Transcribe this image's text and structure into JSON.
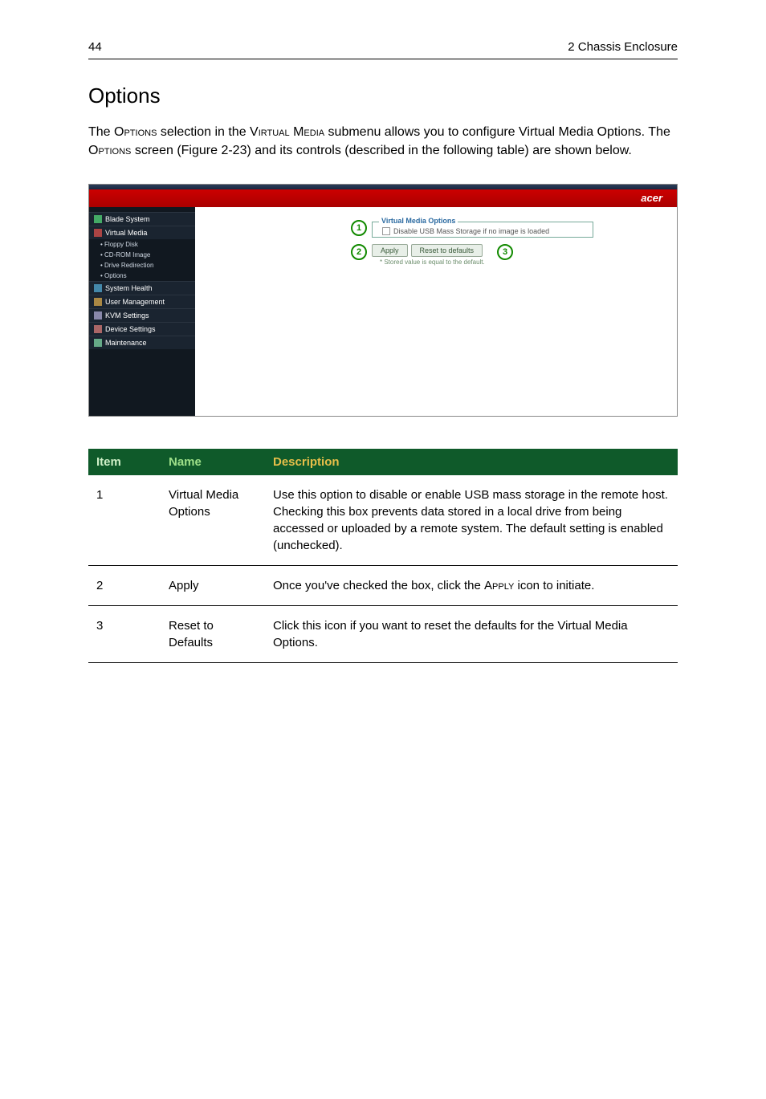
{
  "header": {
    "page_number": "44",
    "chapter": "2 Chassis Enclosure"
  },
  "title": "Options",
  "intro": {
    "p1a": "The ",
    "p1b": "Options",
    "p1c": " selection in the ",
    "p1d": "Virtual Media",
    "p1e": " submenu allows you to configure Virtual Media Options. The ",
    "p1f": "Options",
    "p1g": " screen (Figure 2-23) and its controls (described in the following table) are shown below."
  },
  "screenshot": {
    "brand": "acer",
    "sidebar": {
      "items": [
        {
          "label": "Blade System"
        },
        {
          "label": "Virtual Media"
        },
        {
          "label": "System Health"
        },
        {
          "label": "User Management"
        },
        {
          "label": "KVM Settings"
        },
        {
          "label": "Device Settings"
        },
        {
          "label": "Maintenance"
        }
      ],
      "vm_sub": [
        "Floppy Disk",
        "CD-ROM Image",
        "Drive Redirection",
        "Options"
      ]
    },
    "panel": {
      "legend": "Virtual Media Options",
      "checkbox_label": "Disable USB Mass Storage if no image is loaded",
      "apply": "Apply",
      "reset": "Reset to defaults",
      "hint": "* Stored value is equal to the default."
    },
    "callouts": {
      "c1": "1",
      "c2": "2",
      "c3": "3"
    }
  },
  "table": {
    "headers": {
      "item": "Item",
      "name": "Name",
      "desc": "Description"
    },
    "rows": [
      {
        "item": "1",
        "name": "Virtual Media Options",
        "desc": "Use this option to disable or enable USB mass storage in the remote host. Checking this box prevents data stored in a local drive from being accessed or uploaded by a remote system. The default setting is enabled (unchecked)."
      },
      {
        "item": "2",
        "name": "Apply",
        "desc_a": "Once you've checked the box, click the ",
        "desc_b": "Apply",
        "desc_c": " icon to initiate."
      },
      {
        "item": "3",
        "name": "Reset to Defaults",
        "desc": "Click this icon if you want to reset the defaults for the Virtual Media Options."
      }
    ]
  }
}
